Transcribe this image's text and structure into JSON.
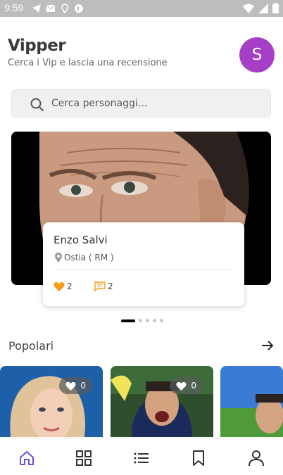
{
  "status_bar": {
    "time": "9:59"
  },
  "header": {
    "title": "Vipper",
    "subtitle": "Cerca i Vip e lascia una recensione",
    "avatar_letter": "S",
    "avatar_color": "#a73ec6"
  },
  "search": {
    "placeholder": "Cerca personaggi..."
  },
  "featured": {
    "name": "Enzo Salvi",
    "location": "Ostia ( RM )",
    "likes": "2",
    "reviews": "2",
    "like_color": "#f39c12",
    "review_color": "#f39c12",
    "slides_count": 5,
    "active_slide": 0
  },
  "popular": {
    "title": "Popolari",
    "items": [
      {
        "likes": "0"
      },
      {
        "likes": "0"
      },
      {
        "likes": ""
      }
    ]
  },
  "nav": {
    "items": [
      "home-icon",
      "grid-icon",
      "list-icon",
      "bookmark-icon",
      "profile-icon"
    ],
    "active_color": "#6c4de6",
    "inactive_color": "#333333"
  }
}
